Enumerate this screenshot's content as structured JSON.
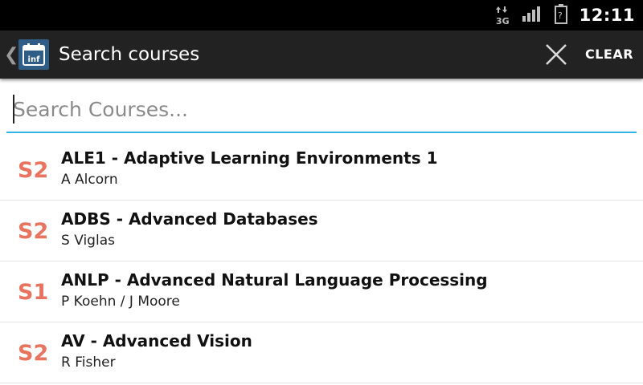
{
  "status_bar": {
    "network": "3G",
    "network_icon": "data-arrows-icon",
    "signal_icon": "signal-bars-icon",
    "battery_icon": "battery-unknown-icon",
    "time": "12:11"
  },
  "action_bar": {
    "title": "Search courses",
    "clear_label": "CLEAR",
    "app_icon_text": "inf",
    "back_icon": "chevron-left-icon",
    "close_icon": "close-icon"
  },
  "search": {
    "value": "",
    "placeholder": "Search Courses..."
  },
  "colors": {
    "accent": "#33b5e5",
    "semester": "#e8735e",
    "action_bar": "#222222",
    "status_bar": "#000000"
  },
  "courses": [
    {
      "semester": "S2",
      "title": "ALE1 - Adaptive Learning Environments 1",
      "lecturer": "A Alcorn"
    },
    {
      "semester": "S2",
      "title": "ADBS - Advanced Databases",
      "lecturer": "S Viglas"
    },
    {
      "semester": "S1",
      "title": "ANLP - Advanced Natural Language Processing",
      "lecturer": "P Koehn / J Moore"
    },
    {
      "semester": "S2",
      "title": "AV - Advanced Vision",
      "lecturer": "R Fisher"
    }
  ]
}
